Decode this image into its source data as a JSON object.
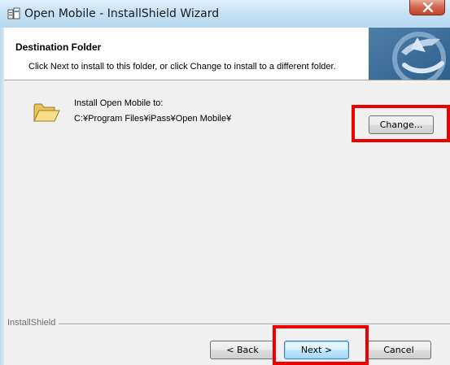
{
  "window": {
    "title": "Open Mobile - InstallShield Wizard",
    "close_label": "X",
    "icons": {
      "app": "installer-icon",
      "close": "close-icon"
    }
  },
  "banner": {
    "title": "Destination Folder",
    "subtitle": "Click Next to install to this folder, or click Change to install to a different folder.",
    "art_icon": "installshield-logo-icon"
  },
  "content": {
    "install_label": "Install Open Mobile to:",
    "install_path": "C:¥Program Files¥iPass¥Open Mobile¥",
    "folder_icon": "folder-icon",
    "change_label": "Change..."
  },
  "footer": {
    "brand": "InstallShield",
    "back_label": "< Back",
    "next_label": "Next >",
    "cancel_label": "Cancel"
  },
  "colors": {
    "highlight": "#ee0000",
    "titlebar": "#c6e2f5",
    "dialog_bg": "#f0f0f0",
    "close_button": "#c2442b"
  }
}
